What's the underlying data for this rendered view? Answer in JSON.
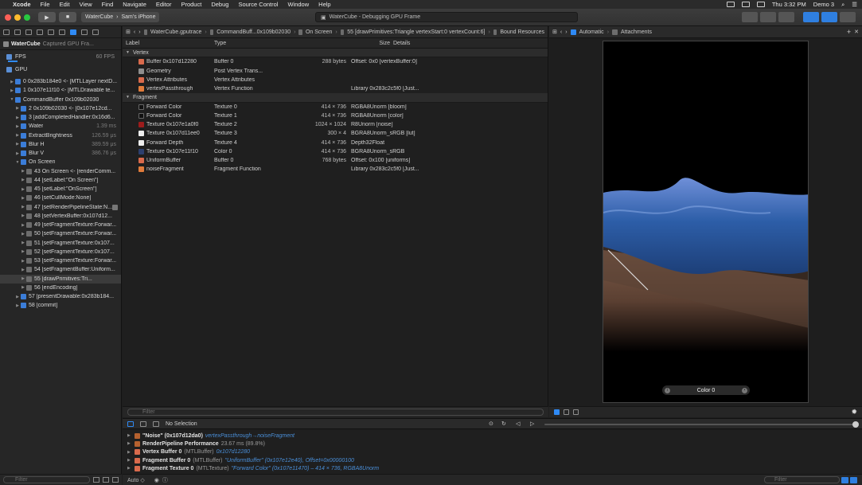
{
  "menubar": {
    "app": "Xcode",
    "items": [
      "File",
      "Edit",
      "View",
      "Find",
      "Navigate",
      "Editor",
      "Product",
      "Debug",
      "Source Control",
      "Window",
      "Help"
    ],
    "clock": "Thu 3:32 PM",
    "user": "Demo 3"
  },
  "toolbar": {
    "scheme": "WaterCube",
    "device": "Sam's iPhone",
    "activity": "WaterCube - Debugging GPU Frame"
  },
  "navigator": {
    "project": "WaterCube",
    "subtitle": "Captured GPU Fra...",
    "fps_label": "FPS",
    "fps_value": "60 FPS",
    "gpu_label": "GPU",
    "items": [
      {
        "label": "0 0x283b184e0 <- [MTLLayer nextD...",
        "time": "",
        "indent": 1,
        "tri": "▶"
      },
      {
        "label": "1 0x107e11f10 <- [MTLDrawable te...",
        "time": "",
        "indent": 1,
        "tri": "▶"
      },
      {
        "label": "CommandBuffer 0x109b02030",
        "time": "",
        "indent": 1,
        "tri": "▼"
      },
      {
        "label": "2 0x109b02030 <- [0x107e12cd...",
        "time": "",
        "indent": 2,
        "tri": "▶"
      },
      {
        "label": "3 [addCompletedHandler:0x16d6...",
        "time": "",
        "indent": 2,
        "tri": "▶"
      },
      {
        "label": "Water",
        "time": "1.39 ms",
        "indent": 2,
        "tri": "▶"
      },
      {
        "label": "ExtractBrightness",
        "time": "126.59 μs",
        "indent": 2,
        "tri": "▶"
      },
      {
        "label": "Blur H",
        "time": "389.59 μs",
        "indent": 2,
        "tri": "▶"
      },
      {
        "label": "Blur V",
        "time": "386.76 μs",
        "indent": 2,
        "tri": "▶"
      },
      {
        "label": "On Screen",
        "time": "",
        "indent": 2,
        "tri": "▼"
      },
      {
        "label": "43 On Screen <- [renderComm...",
        "time": "",
        "indent": 3,
        "tri": "▶"
      },
      {
        "label": "44 [setLabel:\"On Screen\"]",
        "time": "",
        "indent": 3,
        "tri": "▶"
      },
      {
        "label": "45 [setLabel:\"OnScreen\"]",
        "time": "",
        "indent": 3,
        "tri": "▶"
      },
      {
        "label": "46 [setCullMode:None]",
        "time": "",
        "indent": 3,
        "tri": "▶"
      },
      {
        "label": "47 [setRenderPipelineState:N...",
        "time": "",
        "indent": 3,
        "tri": "▶"
      },
      {
        "label": "48 [setVertexBuffer:0x107d12...",
        "time": "",
        "indent": 3,
        "tri": "▶"
      },
      {
        "label": "49 [setFragmentTexture:Forwar...",
        "time": "",
        "indent": 3,
        "tri": "▶"
      },
      {
        "label": "50 [setFragmentTexture:Forwar...",
        "time": "",
        "indent": 3,
        "tri": "▶"
      },
      {
        "label": "51 [setFragmentTexture:0x107...",
        "time": "",
        "indent": 3,
        "tri": "▶"
      },
      {
        "label": "52 [setFragmentTexture:0x107...",
        "time": "",
        "indent": 3,
        "tri": "▶"
      },
      {
        "label": "53 [setFragmentTexture:Forwar...",
        "time": "",
        "indent": 3,
        "tri": "▶"
      },
      {
        "label": "54 [setFragmentBuffer:Uniform...",
        "time": "",
        "indent": 3,
        "tri": "▶"
      },
      {
        "label": "55 [drawPrimitives:Tri...",
        "time": "",
        "indent": 3,
        "tri": "▶",
        "selected": true
      },
      {
        "label": "56 [endEncoding]",
        "time": "",
        "indent": 3,
        "tri": "▶"
      },
      {
        "label": "57 [presentDrawable:0x283b184...",
        "time": "",
        "indent": 2,
        "tri": "▶"
      },
      {
        "label": "58 [commit]",
        "time": "",
        "indent": 2,
        "tri": "▶"
      }
    ],
    "filter_placeholder": "Filter"
  },
  "jumpbar": {
    "items": [
      "WaterCube.gputrace",
      "CommandBuff...0x109b02030",
      "On Screen",
      "55 [drawPrimitives:Triangle vertexStart:0 vertexCount:6]",
      "Bound Resources"
    ]
  },
  "resources": {
    "columns": {
      "label": "Label",
      "type": "Type",
      "size": "Size",
      "details": "Details"
    },
    "sections": [
      {
        "title": "Vertex",
        "rows": [
          {
            "label": "Buffer 0x107d12280",
            "type": "Buffer 0",
            "size": "288 bytes",
            "details": "Offset: 0x0 [vertexBuffer:0]",
            "icon": "buf"
          },
          {
            "label": "Geometry",
            "type": "Post Vertex Trans...",
            "size": "",
            "details": "",
            "icon": "geo"
          },
          {
            "label": "Vertex Attributes",
            "type": "Vertex Attributes",
            "size": "",
            "details": "",
            "icon": "buf"
          },
          {
            "label": "vertexPassthrough",
            "type": "Vertex Function",
            "size": "",
            "details": "Library 0x283c2c5f0 [Just...",
            "icon": "fn"
          }
        ]
      },
      {
        "title": "Fragment",
        "rows": [
          {
            "label": "Forward Color",
            "type": "Texture 0",
            "size": "414 × 736",
            "details": "RGBA8Unorm [bloom]",
            "icon": "tex-dark"
          },
          {
            "label": "Forward Color",
            "type": "Texture 1",
            "size": "414 × 736",
            "details": "RGBA8Unorm [color]",
            "icon": "tex-dark"
          },
          {
            "label": "Texture 0x107e1a0f0",
            "type": "Texture 2",
            "size": "1024 × 1024",
            "details": "R8Unorm [noise]",
            "icon": "tex-red"
          },
          {
            "label": "Texture 0x107d11ee0",
            "type": "Texture 3",
            "size": "300 × 4",
            "details": "BGRA8Unorm_sRGB [lut]",
            "icon": "tex-white"
          },
          {
            "label": "Forward Depth",
            "type": "Texture 4",
            "size": "414 × 736",
            "details": "Depth32Float",
            "icon": "tex-white"
          },
          {
            "label": "Texture 0x107e11f10",
            "type": "Color 0",
            "size": "414 × 736",
            "details": "BGRA8Unorm_sRGB",
            "icon": "tex-blue"
          },
          {
            "label": "UniformBuffer",
            "type": "Buffer 0",
            "size": "768 bytes",
            "details": "Offset: 0x100 [uniforms]",
            "icon": "buf"
          },
          {
            "label": "noiseFragment",
            "type": "Fragment Function",
            "size": "",
            "details": "Library 0x283c2c5f0 [Just...",
            "icon": "fn"
          }
        ]
      }
    ],
    "filter_placeholder": "Filter"
  },
  "viewer": {
    "jump_left": "Automatic",
    "jump_right": "Attachments",
    "attachment_label": "Color 0"
  },
  "debugbar": {
    "selection": "No Selection"
  },
  "console": {
    "rows": [
      {
        "key": "\"Noise\" (0x107d12da0)",
        "meta": "",
        "value": "vertexPassthrough→noiseFragment",
        "icon": "perf"
      },
      {
        "key": "RenderPipeline Performance",
        "meta": "23.67 ms (89.8%)",
        "value": "",
        "icon": "perf"
      },
      {
        "key": "Vertex Buffer 0",
        "meta": "(MTLBuffer)",
        "value": "0x107d12280",
        "icon": "buf"
      },
      {
        "key": "Fragment Buffer 0",
        "meta": "(MTLBuffer)",
        "value": "\"UniformBuffer\" (0x107e12e40), Offset=0x00000100",
        "icon": "buf"
      },
      {
        "key": "Fragment Texture 0",
        "meta": "(MTLTexture)",
        "value": "\"Forward Color\" (0x107e11470) – 414 × 736, RGBA8Unorm",
        "icon": "buf"
      }
    ],
    "auto_label": "Auto ◇",
    "filter_placeholder": "Filter"
  }
}
